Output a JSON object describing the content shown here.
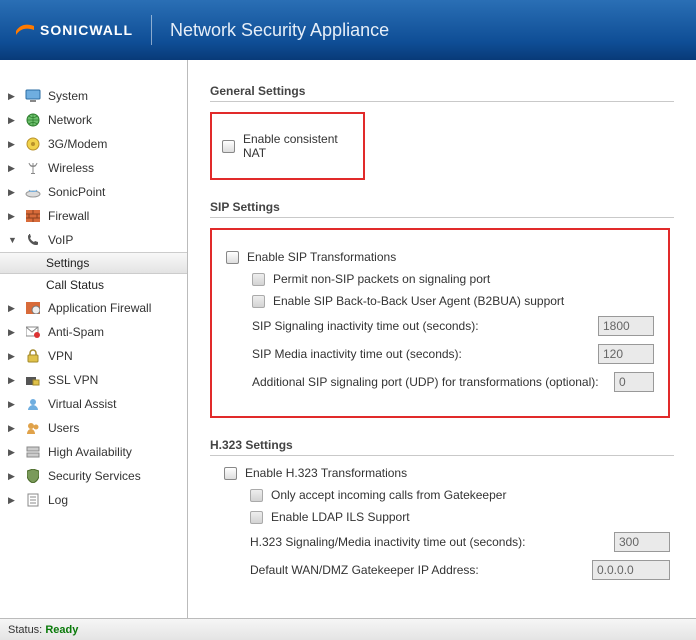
{
  "header": {
    "brand": "SONICWALL",
    "product": "Network Security Appliance"
  },
  "sidebar": {
    "items": [
      {
        "label": "System"
      },
      {
        "label": "Network"
      },
      {
        "label": "3G/Modem"
      },
      {
        "label": "Wireless"
      },
      {
        "label": "SonicPoint"
      },
      {
        "label": "Firewall"
      },
      {
        "label": "VoIP"
      },
      {
        "label": "Application Firewall"
      },
      {
        "label": "Anti-Spam"
      },
      {
        "label": "VPN"
      },
      {
        "label": "SSL VPN"
      },
      {
        "label": "Virtual Assist"
      },
      {
        "label": "Users"
      },
      {
        "label": "High Availability"
      },
      {
        "label": "Security Services"
      },
      {
        "label": "Log"
      }
    ],
    "voip_sub": {
      "settings": "Settings",
      "callstatus": "Call Status"
    }
  },
  "main": {
    "general": {
      "title": "General Settings",
      "enable_nat": "Enable consistent NAT"
    },
    "sip": {
      "title": "SIP Settings",
      "enable_transform": "Enable SIP Transformations",
      "permit_nonsip": "Permit non-SIP packets on signaling port",
      "enable_b2bua": "Enable SIP Back-to-Back User Agent (B2BUA) support",
      "signal_timeout_label": "SIP Signaling inactivity time out (seconds):",
      "signal_timeout_value": "1800",
      "media_timeout_label": "SIP Media inactivity time out (seconds):",
      "media_timeout_value": "120",
      "addl_port_label": "Additional SIP signaling port (UDP) for transformations (optional):",
      "addl_port_value": "0"
    },
    "h323": {
      "title": "H.323 Settings",
      "enable_transform": "Enable H.323 Transformations",
      "only_gatekeeper": "Only accept incoming calls from Gatekeeper",
      "enable_ldap": "Enable LDAP ILS Support",
      "signal_timeout_label": "H.323 Signaling/Media inactivity time out (seconds):",
      "signal_timeout_value": "300",
      "gatekeeper_ip_label": "Default WAN/DMZ Gatekeeper IP Address:",
      "gatekeeper_ip_value": "0.0.0.0"
    }
  },
  "status": {
    "label": "Status:",
    "value": "Ready"
  }
}
